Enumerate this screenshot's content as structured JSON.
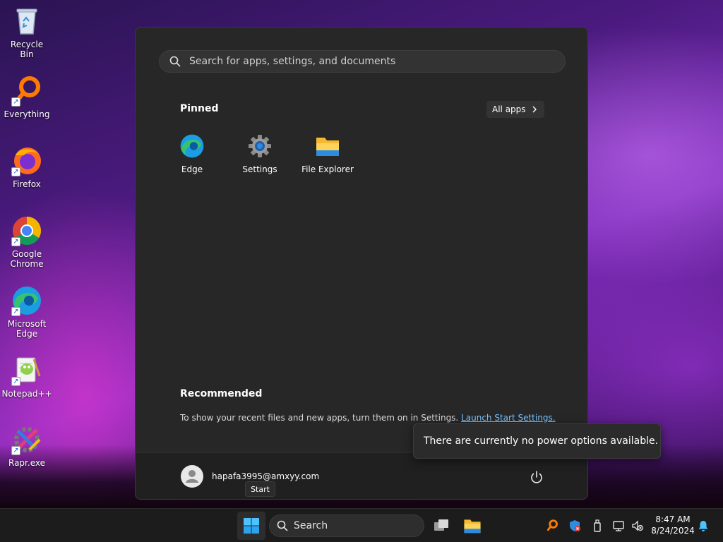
{
  "desktop": {
    "icons": [
      {
        "label": "Recycle Bin",
        "icon": "recycle-bin-icon"
      },
      {
        "label": "Everything",
        "icon": "everything-icon"
      },
      {
        "label": "Firefox",
        "icon": "firefox-icon"
      },
      {
        "label": "Google Chrome",
        "icon": "chrome-icon"
      },
      {
        "label": "Microsoft Edge",
        "icon": "edge-icon"
      },
      {
        "label": "Notepad++",
        "icon": "notepadpp-icon"
      },
      {
        "label": "Rapr.exe",
        "icon": "rapr-icon"
      }
    ]
  },
  "start_menu": {
    "search_placeholder": "Search for apps, settings, and documents",
    "pinned_title": "Pinned",
    "all_apps_label": "All apps",
    "pinned": [
      {
        "label": "Edge",
        "icon": "edge-icon"
      },
      {
        "label": "Settings",
        "icon": "settings-gear-icon"
      },
      {
        "label": "File Explorer",
        "icon": "folder-icon"
      }
    ],
    "recommended_title": "Recommended",
    "recommended_text": "To show your recent files and new apps, turn them on in Settings.",
    "recommended_link": "Launch Start Settings.",
    "user_name": "hapafa3995@amxyy.com"
  },
  "tooltips": {
    "power": "There are currently no power options available.",
    "start": "Start"
  },
  "taskbar": {
    "search_label": "Search",
    "time": "8:47 AM",
    "date": "8/24/2024"
  },
  "colors": {
    "accent": "#0078d4",
    "link": "#7cc4ff",
    "menu_bg": "#272727"
  }
}
